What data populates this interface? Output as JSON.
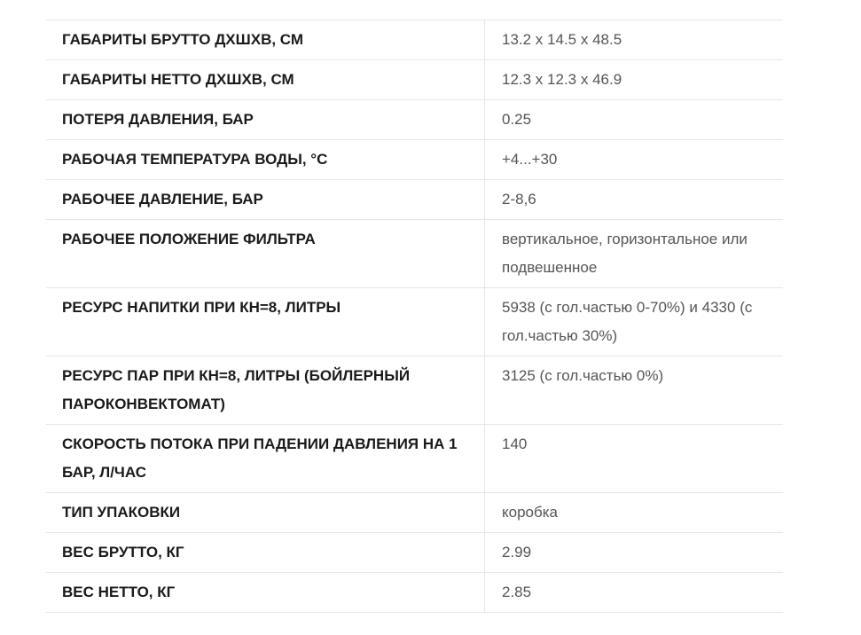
{
  "specs": {
    "rows": [
      {
        "label": "ГАБАРИТЫ БРУТТО ДХШХВ, СМ",
        "value": "13.2 x 14.5 x 48.5"
      },
      {
        "label": "ГАБАРИТЫ НЕТТО ДХШХВ, СМ",
        "value": "12.3 x 12.3 x 46.9"
      },
      {
        "label": "ПОТЕРЯ ДАВЛЕНИЯ, БАР",
        "value": "0.25"
      },
      {
        "label": "РАБОЧАЯ ТЕМПЕРАТУРА ВОДЫ, °С",
        "value": "+4...+30"
      },
      {
        "label": "РАБОЧЕЕ ДАВЛЕНИЕ, БАР",
        "value": "2-8,6"
      },
      {
        "label": "РАБОЧЕЕ ПОЛОЖЕНИЕ ФИЛЬТРА",
        "value": "вертикальное, горизонтальное или подвешенное"
      },
      {
        "label": "РЕСУРС НАПИТКИ ПРИ КН=8, ЛИТРЫ",
        "value": "5938 (с гол.частью 0-70%) и 4330 (с гол.частью 30%)"
      },
      {
        "label": "РЕСУРС ПАР ПРИ КН=8, ЛИТРЫ (БОЙЛЕРНЫЙ ПАРОКОНВЕКТОМАТ)",
        "value": "3125 (с гол.частью 0%)"
      },
      {
        "label": "СКОРОСТЬ ПОТОКА ПРИ ПАДЕНИИ ДАВЛЕНИЯ НА 1 БАР, Л/ЧАС",
        "value": "140"
      },
      {
        "label": "ТИП УПАКОВКИ",
        "value": "коробка"
      },
      {
        "label": "ВЕС БРУТТО, КГ",
        "value": "2.99"
      },
      {
        "label": "ВЕС НЕТТО, КГ",
        "value": "2.85"
      }
    ]
  }
}
